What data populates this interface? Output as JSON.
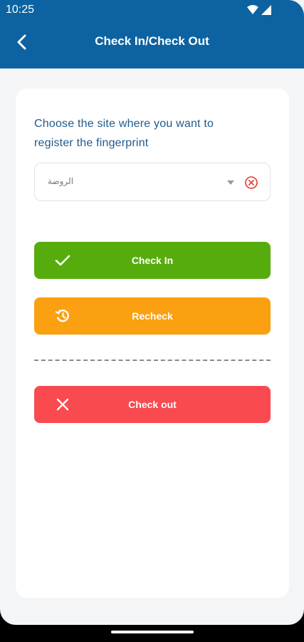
{
  "status_bar": {
    "time": "10:25"
  },
  "header": {
    "title": "Check In/Check Out"
  },
  "card": {
    "prompt": "Choose the site where you want to register the fingerprint",
    "site_select": {
      "value": "الروضة"
    }
  },
  "buttons": {
    "check_in": {
      "label": "Check In",
      "icon": "check-icon",
      "color": "#57ac0d"
    },
    "recheck": {
      "label": "Recheck",
      "icon": "history-icon",
      "color": "#fba010"
    },
    "check_out": {
      "label": "Check out",
      "icon": "close-icon",
      "color": "#f84a4f"
    }
  },
  "colors": {
    "appbar": "#0d63a1",
    "prompt_text": "#1f5a8e",
    "background": "#f3f5f7"
  }
}
